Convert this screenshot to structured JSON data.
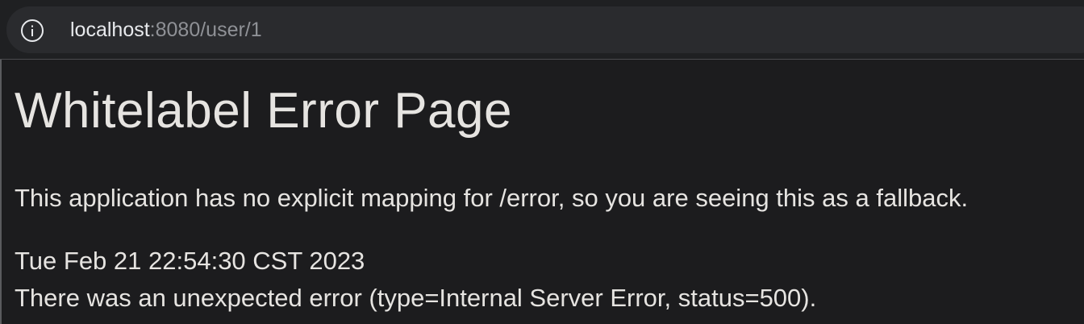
{
  "browser": {
    "address_bar": {
      "host": "localhost",
      "path": ":8080/user/1",
      "icon": "info-icon"
    }
  },
  "page": {
    "title": "Whitelabel Error Page",
    "message": "This application has no explicit mapping for /error, so you are seeing this as a fallback.",
    "timestamp": "Tue Feb 21 22:54:30 CST 2023",
    "error_detail": "There was an unexpected error (type=Internal Server Error, status=500)."
  }
}
